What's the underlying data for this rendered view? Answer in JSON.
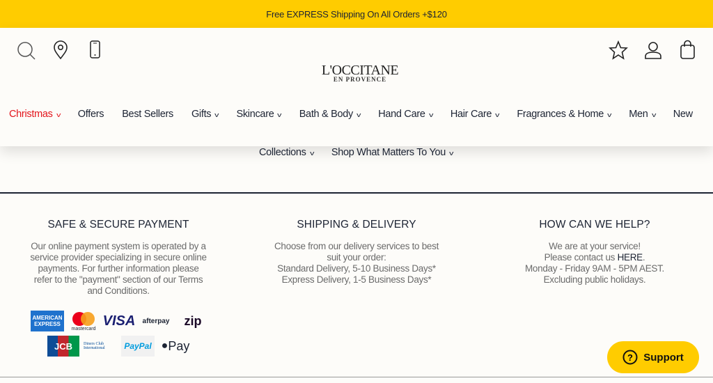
{
  "promo": {
    "text": "Free EXPRESS Shipping On All Orders +$120"
  },
  "logo": {
    "line1": "L'OCCITANE",
    "line2": "EN PROVENCE"
  },
  "nav": {
    "items": [
      {
        "label": "Christmas",
        "dropdown": true,
        "highlight": "#e3141b"
      },
      {
        "label": "Offers",
        "dropdown": false
      },
      {
        "label": "Best Sellers",
        "dropdown": false
      },
      {
        "label": "Gifts",
        "dropdown": true
      },
      {
        "label": "Skincare",
        "dropdown": true
      },
      {
        "label": "Bath & Body",
        "dropdown": true
      },
      {
        "label": "Hand Care",
        "dropdown": true
      },
      {
        "label": "Hair Care",
        "dropdown": true
      },
      {
        "label": "Fragrances & Home",
        "dropdown": true
      },
      {
        "label": "Men",
        "dropdown": true
      },
      {
        "label": "New",
        "dropdown": false
      }
    ],
    "row2": [
      {
        "label": "Collections",
        "dropdown": true
      },
      {
        "label": "Shop What Matters To You",
        "dropdown": true
      }
    ]
  },
  "footer": {
    "payment": {
      "title": "SAFE & SECURE PAYMENT",
      "text": "Our online payment system is operated by a service provider specializing in secure online payments. For further information please refer to the \"payment\" section of our Terms and Conditions.",
      "cards": [
        "AMERICAN EXPRESS",
        "mastercard",
        "VISA",
        "afterpay",
        "zip",
        "JCB",
        "Diners Club International",
        "PayPal",
        "Pay"
      ]
    },
    "shipping": {
      "title": "SHIPPING & DELIVERY",
      "lines": [
        "Choose from our delivery services to best suit your order:",
        "Standard Delivery, 5-10 Business Days*",
        "Express Delivery, 1-5 Business Days*"
      ]
    },
    "help": {
      "title": "HOW CAN WE HELP?",
      "line1": "We are at your service!",
      "line2_pre": "Please contact us ",
      "line2_link": "HERE",
      "line2_post": ".",
      "line3": "Monday - Friday 9AM - 5PM AEST.",
      "line4": "Excluding public holidays."
    }
  },
  "support": {
    "label": "Support"
  },
  "colors": {
    "accent": "#ffcc00",
    "christmas": "#e3141b",
    "text": "#1c2333"
  }
}
